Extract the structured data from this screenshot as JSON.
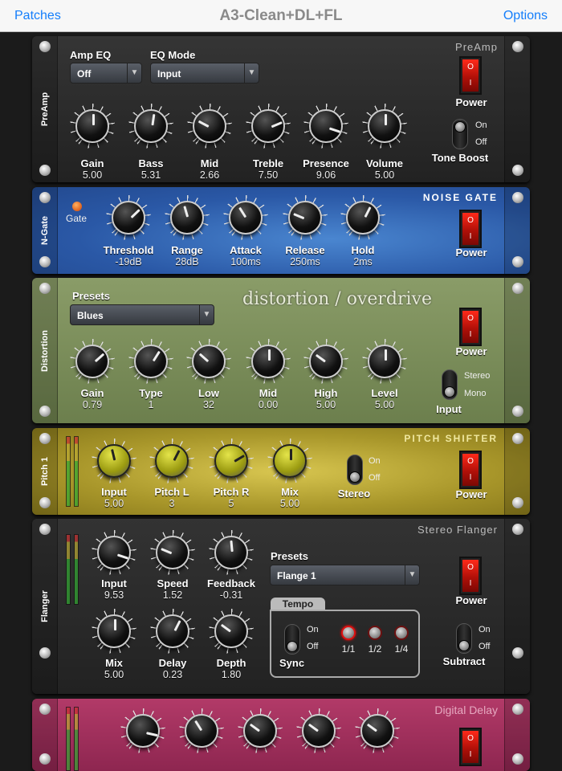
{
  "nav": {
    "left": "Patches",
    "title": "A3-Clean+DL+FL",
    "right": "Options"
  },
  "preamp": {
    "side": "PreAmp",
    "title": "PreAmp",
    "amp_eq_label": "Amp EQ",
    "amp_eq_value": "Off",
    "eq_mode_label": "EQ Mode",
    "eq_mode_value": "Input",
    "power": "Power",
    "power_on": true,
    "tone_boost": "Tone Boost",
    "on": "On",
    "off": "Off",
    "tone_boost_on": true,
    "knobs": [
      {
        "label": "Gain",
        "value": "5.00",
        "level": 0.5
      },
      {
        "label": "Bass",
        "value": "5.31",
        "level": 0.53
      },
      {
        "label": "Mid",
        "value": "2.66",
        "level": 0.27
      },
      {
        "label": "Treble",
        "value": "7.50",
        "level": 0.75
      },
      {
        "label": "Presence",
        "value": "9.06",
        "level": 0.9
      },
      {
        "label": "Volume",
        "value": "5.00",
        "level": 0.5
      }
    ]
  },
  "ngate": {
    "side": "N-Gate",
    "title": "NOISE GATE",
    "gate": "Gate",
    "power": "Power",
    "knobs": [
      {
        "label": "Threshold",
        "value": "-19dB",
        "level": 0.67
      },
      {
        "label": "Range",
        "value": "28dB",
        "level": 0.44
      },
      {
        "label": "Attack",
        "value": "100ms",
        "level": 0.38
      },
      {
        "label": "Release",
        "value": "250ms",
        "level": 0.25
      },
      {
        "label": "Hold",
        "value": "2ms",
        "level": 0.6
      }
    ]
  },
  "distortion": {
    "side": "Distortion",
    "title": "distortion / overdrive",
    "presets_label": "Presets",
    "preset": "Blues",
    "power": "Power",
    "input": "Input",
    "stereo": "Stereo",
    "mono": "Mono",
    "input_mode": "Mono",
    "knobs": [
      {
        "label": "Gain",
        "value": "0.79",
        "level": 0.68
      },
      {
        "label": "Type",
        "value": "1",
        "level": 0.62
      },
      {
        "label": "Low",
        "value": "32",
        "level": 0.32
      },
      {
        "label": "Mid",
        "value": "0.00",
        "level": 0.5
      },
      {
        "label": "High",
        "value": "5.00",
        "level": 0.3
      },
      {
        "label": "Level",
        "value": "5.00",
        "level": 0.5
      }
    ]
  },
  "pitch": {
    "side": "Pitch 1",
    "title": "PITCH SHIFTER",
    "power": "Power",
    "stereo": "Stereo",
    "on": "On",
    "off": "Off",
    "stereo_on": true,
    "knobs": [
      {
        "label": "Input",
        "value": "5.00",
        "level": 0.45
      },
      {
        "label": "Pitch L",
        "value": "3",
        "level": 0.6
      },
      {
        "label": "Pitch R",
        "value": "5",
        "level": 0.72
      },
      {
        "label": "Mix",
        "value": "5.00",
        "level": 0.5
      }
    ]
  },
  "flanger": {
    "side": "Flanger",
    "title": "Stereo Flanger",
    "presets_label": "Presets",
    "preset": "Flange 1",
    "power": "Power",
    "tempo": "Tempo",
    "sync": "Sync",
    "subtract": "Subtract",
    "on": "On",
    "off": "Off",
    "tempo_options": [
      "1/1",
      "1/2",
      "1/4"
    ],
    "tempo_selected": "1/1",
    "knobs": [
      {
        "label": "Input",
        "value": "9.53",
        "level": 0.9
      },
      {
        "label": "Speed",
        "value": "1.52",
        "level": 0.25
      },
      {
        "label": "Feedback",
        "value": "-0.31",
        "level": 0.48
      },
      {
        "label": "Mix",
        "value": "5.00",
        "level": 0.5
      },
      {
        "label": "Delay",
        "value": "0.23",
        "level": 0.6
      },
      {
        "label": "Depth",
        "value": "1.80",
        "level": 0.3
      }
    ]
  },
  "delay": {
    "title": "Digital Delay",
    "knobs": [
      {
        "level": 0.88
      },
      {
        "level": 0.38
      },
      {
        "level": 0.3
      },
      {
        "level": 0.3
      },
      {
        "level": 0.3
      }
    ]
  },
  "colors": {
    "accent": "#147efb",
    "preamp": "#2b2b2b",
    "ngate": "#2f60b0",
    "distortion": "#7d8f5c",
    "pitch": "#b4a232",
    "flanger": "#2a2a2a",
    "delay": "#a3305e",
    "power_red": "#e01a10"
  }
}
